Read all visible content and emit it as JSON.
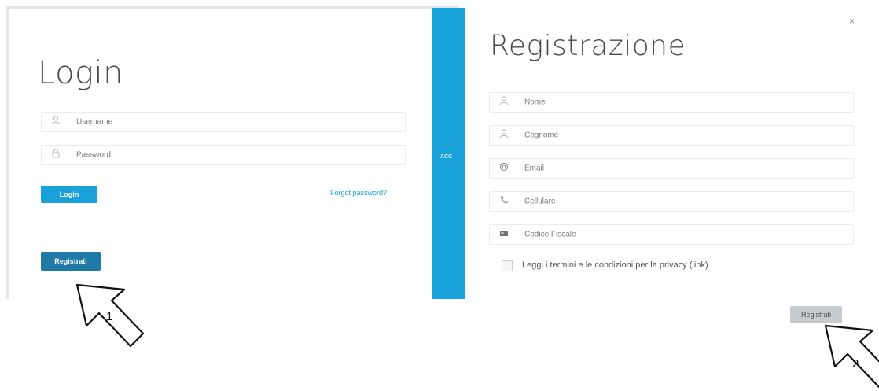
{
  "login": {
    "title": "Login",
    "username_placeholder": "Username",
    "password_placeholder": "Password",
    "login_button": "Login",
    "forgot_link": "Forgot password?",
    "register_button": "Registrati"
  },
  "side_strip": {
    "label": "ACC"
  },
  "registration": {
    "title": "Registrazione",
    "close": "×",
    "fields": [
      {
        "placeholder": "Nome",
        "icon": "user-icon"
      },
      {
        "placeholder": "Cognome",
        "icon": "user-icon"
      },
      {
        "placeholder": "Email",
        "icon": "email-icon"
      },
      {
        "placeholder": "Cellulare",
        "icon": "phone-icon"
      },
      {
        "placeholder": "Codice Fiscale",
        "icon": "id-card-icon"
      }
    ],
    "terms_text": "Leggi i termini e le condizioni per la privacy (link)",
    "submit_button": "Registrati"
  },
  "callouts": {
    "step1": "1",
    "step2": "2"
  },
  "colors": {
    "accent": "#1ba1d9",
    "accent_dark": "#1f7aa6",
    "submit_gray": "#c7cbce"
  }
}
